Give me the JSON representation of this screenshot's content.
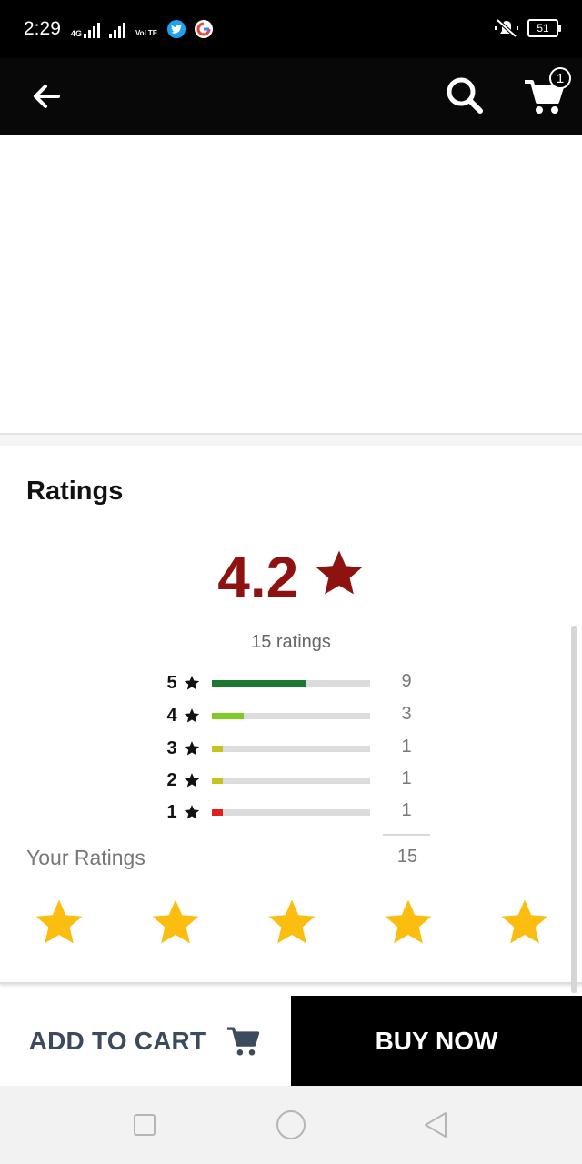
{
  "status_bar": {
    "time": "2:29",
    "network_type": "4G",
    "volte_label": "VoLTE",
    "battery": "51",
    "icons": [
      "signal-icon",
      "twitter-icon",
      "google-icon",
      "mute-icon",
      "battery-icon"
    ]
  },
  "app_bar": {
    "cart_count": "1",
    "icons": [
      "back-arrow-icon",
      "search-icon",
      "cart-icon"
    ]
  },
  "ratings": {
    "title": "Ratings",
    "average": "4.2",
    "count_text": "15 ratings",
    "breakdown": [
      {
        "stars": "5",
        "count": "9",
        "fraction": 0.6,
        "color": "#1b7a2f"
      },
      {
        "stars": "4",
        "count": "3",
        "fraction": 0.2,
        "color": "#7ecb22"
      },
      {
        "stars": "3",
        "count": "1",
        "fraction": 0.067,
        "color": "#c8c21e"
      },
      {
        "stars": "2",
        "count": "1",
        "fraction": 0.067,
        "color": "#c8c21e"
      },
      {
        "stars": "1",
        "count": "1",
        "fraction": 0.067,
        "color": "#e0201a"
      }
    ],
    "total": "15",
    "your_ratings_label": "Your Ratings",
    "user_stars": 5,
    "colors": {
      "average": "#8e1210",
      "user_star": "#fbbd10"
    }
  },
  "actions": {
    "add_to_cart": "ADD TO CART",
    "buy_now": "BUY NOW"
  }
}
